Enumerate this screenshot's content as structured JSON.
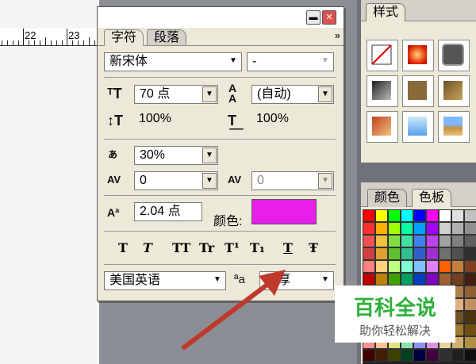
{
  "ruler": {
    "labels": [
      "22",
      "23"
    ]
  },
  "panel": {
    "tabs": [
      "字符",
      "段落"
    ],
    "menu_arrow": "»",
    "font_family": "新宋体",
    "font_style": "-",
    "font_size": "70 点",
    "leading": "(自动)",
    "vertical_scale": "100%",
    "horizontal_scale": "100%",
    "tsume": "30%",
    "kerning": "0",
    "tracking": "0",
    "baseline_shift": "2.04 点",
    "color_label": "颜色:",
    "text_color": "#e81fe8",
    "style_buttons": [
      "T",
      "T",
      "TT",
      "Tr",
      "T¹",
      "T₁",
      "T",
      "Ŧ"
    ],
    "language": "美国英语",
    "anti_alias": "浑厚",
    "anti_alias_icon": "ªa"
  },
  "styles_panel": {
    "tab": "样式"
  },
  "swatches_panel": {
    "tabs": [
      "颜色",
      "色板"
    ]
  },
  "watermark": {
    "title": "百科全说",
    "subtitle": "助你轻松解决"
  },
  "colors": {
    "accent_arrow": "#c0392b",
    "watermark_green": "#2fb03a"
  }
}
